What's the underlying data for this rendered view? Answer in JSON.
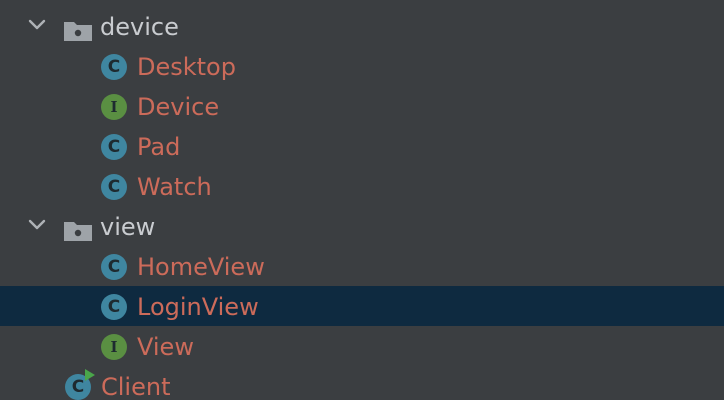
{
  "tree": {
    "packages": [
      {
        "name": "device",
        "children": [
          {
            "name": "Desktop",
            "kind": "C"
          },
          {
            "name": "Device",
            "kind": "I"
          },
          {
            "name": "Pad",
            "kind": "C"
          },
          {
            "name": "Watch",
            "kind": "C"
          }
        ]
      },
      {
        "name": "view",
        "children": [
          {
            "name": "HomeView",
            "kind": "C"
          },
          {
            "name": "LoginView",
            "kind": "C"
          },
          {
            "name": "View",
            "kind": "I"
          }
        ]
      }
    ],
    "root_file": {
      "name": "Client",
      "kind": "C"
    }
  },
  "colors": {
    "background": "#3b3e41",
    "selection": "#0e2a40",
    "modified_text": "#cc6b5a",
    "package_text": "#c9ccd0",
    "class_badge": "#3f86a0",
    "interface_badge": "#5a8f42"
  },
  "icons": {
    "expand": "chevron-down-icon",
    "package": "package-folder-icon",
    "class": "class-icon",
    "interface": "interface-icon",
    "runnable_class": "runnable-class-icon"
  }
}
